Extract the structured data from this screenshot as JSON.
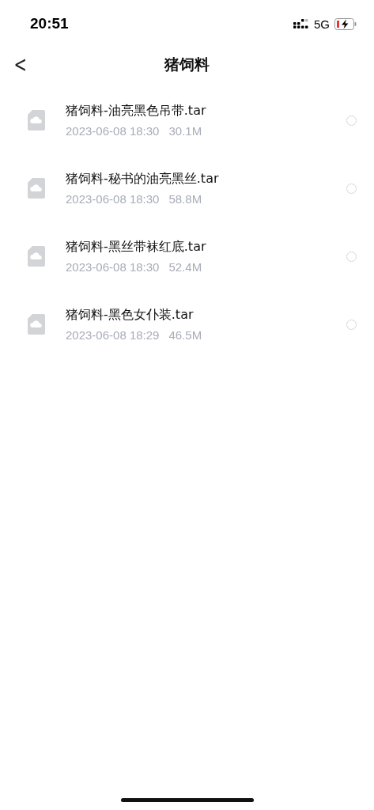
{
  "status_bar": {
    "time": "20:51",
    "network": "5G"
  },
  "nav": {
    "back": "<",
    "title": "猪饲料"
  },
  "files": [
    {
      "name": "猪饲料-油亮黑色吊带.tar",
      "date": "2023-06-08 18:30",
      "size": "30.1M",
      "selected": false
    },
    {
      "name": "猪饲料-秘书的油亮黑丝.tar",
      "date": "2023-06-08 18:30",
      "size": "58.8M",
      "selected": false
    },
    {
      "name": "猪饲料-黑丝带袜红底.tar",
      "date": "2023-06-08 18:30",
      "size": "52.4M",
      "selected": false
    },
    {
      "name": "猪饲料-黑色女仆装.tar",
      "date": "2023-06-08 18:29",
      "size": "46.5M",
      "selected": false
    }
  ]
}
